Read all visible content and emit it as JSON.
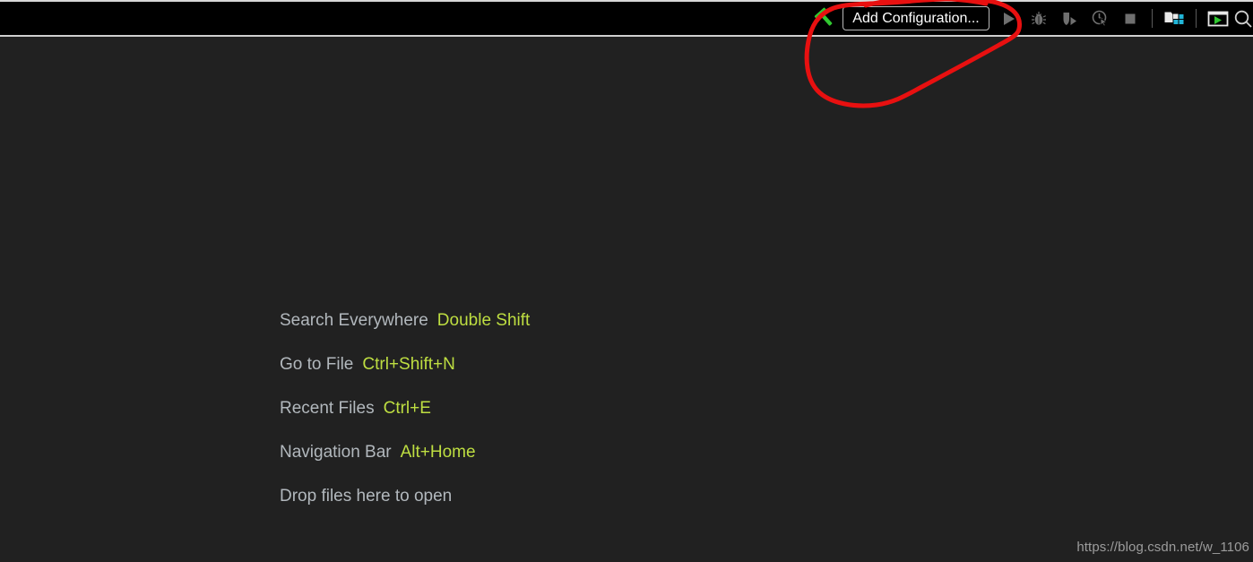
{
  "window": {
    "background_color": "#212121",
    "toolbar_background_color": "#000000"
  },
  "toolbar": {
    "build_icon_name": "hammer-build-icon",
    "build_icon_color": "#31c831",
    "add_configuration_label": "Add Configuration...",
    "run_icon_name": "run-play-icon",
    "debug_icon_name": "debug-bug-icon",
    "run_with_coverage_icon_name": "run-with-coverage-icon",
    "profile_icon_name": "profiler-clock-icon",
    "stop_icon_name": "stop-square-icon",
    "project_structure_icon_name": "project-structure-folder-icon",
    "project_structure_icon_color": "#21b5d8",
    "terminal_icon_name": "run-window-icon",
    "terminal_icon_color": "#31c831",
    "search_icon_name": "search-magnifier-icon",
    "icon_color": "#6f6f6f"
  },
  "editor": {
    "hints": [
      {
        "label": "Search Everywhere",
        "shortcut": "Double Shift"
      },
      {
        "label": "Go to File",
        "shortcut": "Ctrl+Shift+N"
      },
      {
        "label": "Recent Files",
        "shortcut": "Ctrl+E"
      },
      {
        "label": "Navigation Bar",
        "shortcut": "Alt+Home"
      },
      {
        "label": "Drop files here to open",
        "shortcut": ""
      }
    ],
    "hint_label_color": "#b2b8bd",
    "hint_shortcut_color": "#bede41"
  },
  "annotation": {
    "name": "red-circle-highlight",
    "color": "#e81010",
    "stroke_width": 5,
    "target": "Add Configuration..."
  },
  "watermark": {
    "text": "https://blog.csdn.net/w_1106",
    "color": "#9c9c9c"
  }
}
